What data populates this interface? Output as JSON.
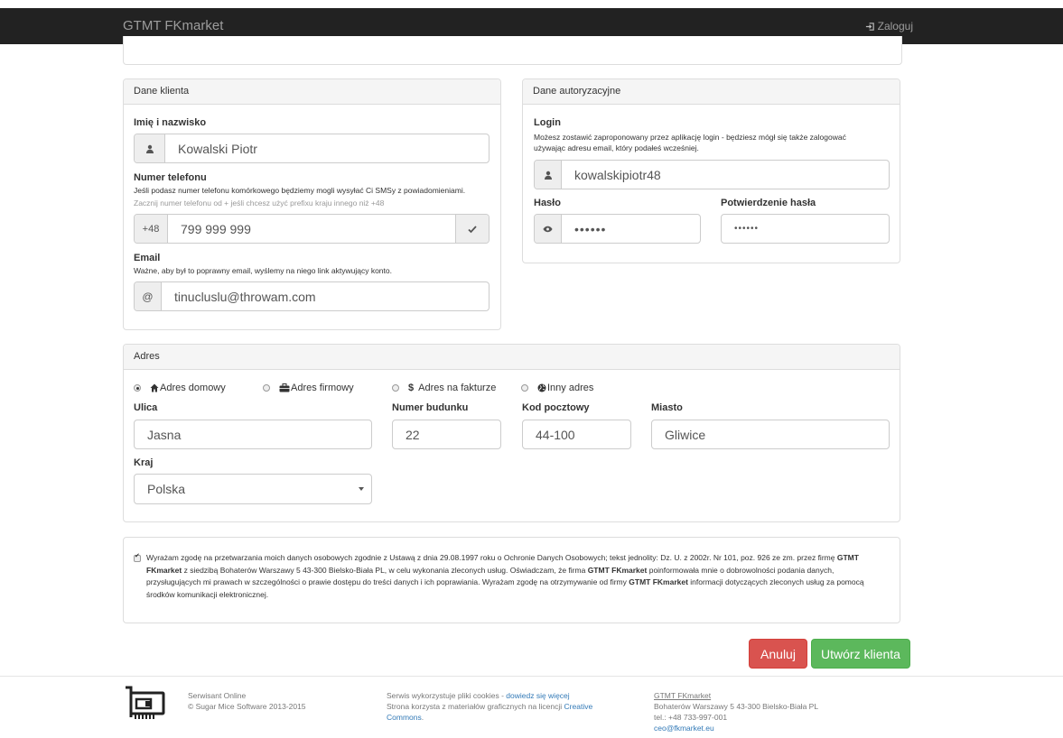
{
  "navbar": {
    "brand": "GTMT FKmarket",
    "login": "Zaloguj"
  },
  "client_panel": {
    "title": "Dane klienta",
    "name_label": "Imię i nazwisko",
    "name_value": "Kowalski Piotr",
    "phone_label": "Numer telefonu",
    "phone_help": "Jeśli podasz numer telefonu komórkowego będziemy mogli wysyłać Ci SMSy z powiadomieniami.",
    "phone_help_muted": "Zacznij numer telefonu od + jeśli chcesz użyć prefixu kraju innego niż +48",
    "phone_prefix": "+48",
    "phone_value": "799 999 999",
    "email_label": "Email",
    "email_help": "Ważne, aby był to poprawny email, wyślemy na niego link aktywujący konto.",
    "email_addon": "@",
    "email_value": "tinucluslu@throwam.com"
  },
  "auth_panel": {
    "title": "Dane autoryzacyjne",
    "login_label": "Login",
    "login_help": "Możesz zostawić zaproponowany przez aplikację login - będziesz mógł się także zalogować używając adresu email, który podałeś wcześniej.",
    "login_value": "kowalskipiotr48",
    "password_label": "Hasło",
    "password_value": "••••••",
    "confirm_label": "Potwierdzenie hasła",
    "confirm_value": "••••••"
  },
  "address_panel": {
    "title": "Adres",
    "types": [
      {
        "label": "Adres domowy",
        "selected": true
      },
      {
        "label": "Adres firmowy",
        "selected": false
      },
      {
        "label": "Adres na fakturze",
        "selected": false
      },
      {
        "label": "Inny adres",
        "selected": false
      }
    ],
    "street_label": "Ulica",
    "street_value": "Jasna",
    "building_label": "Numer budunku",
    "building_value": "22",
    "postal_label": "Kod pocztowy",
    "postal_value": "44-100",
    "city_label": "Miasto",
    "city_value": "Gliwice",
    "country_label": "Kraj",
    "country_value": "Polska"
  },
  "consent": {
    "checked": true,
    "p1": "Wyrażam zgodę na przetwarzania moich danych osobowych zgodnie z Ustawą z dnia 29.08.1997 roku o Ochronie Danych Osobowych; tekst jednolity: Dz. U. z 2002r. Nr 101, poz. 926 ze zm. przez firmę",
    "company1": "GTMT FKmarket",
    "p2": "z siedzibą Bohaterów Warszawy 5 43-300 Bielsko-Biała PL, w celu wykonania zleconych usług. Oświadczam, że firma",
    "company2": "GTMT FKmarket",
    "p3": "poinformowała mnie o dobrowolności podania danych, przysługujących mi prawach w szczególności o prawie dostępu do treści danych i ich poprawiania. Wyrażam zgodę na otrzymywanie od firmy",
    "company3": "GTMT FKmarket",
    "p4": "informacji dotyczących zleconych usług za pomocą środków komunikacji elektronicznej."
  },
  "buttons": {
    "cancel": "Anuluj",
    "create": "Utwórz klienta"
  },
  "footer": {
    "col1_line1": "Serwisant Online",
    "col1_line2": "© Sugar Mice Software 2013-2015",
    "col2_text1": "Serwis wykorzystuje pliki cookies - ",
    "col2_link1": "dowiedz się więcej",
    "col2_text2": "Strona korzysta z materiałów graficznych na licencji ",
    "col2_link2": "Creative Commons",
    "col3_company": "GTMT FKmarket",
    "col3_address": "Bohaterów Warszawy 5 43-300 Bielsko-Biała PL",
    "col3_phone": "tel.: +48 733-997-001",
    "col3_email": "ceo@fkmarket.eu"
  }
}
